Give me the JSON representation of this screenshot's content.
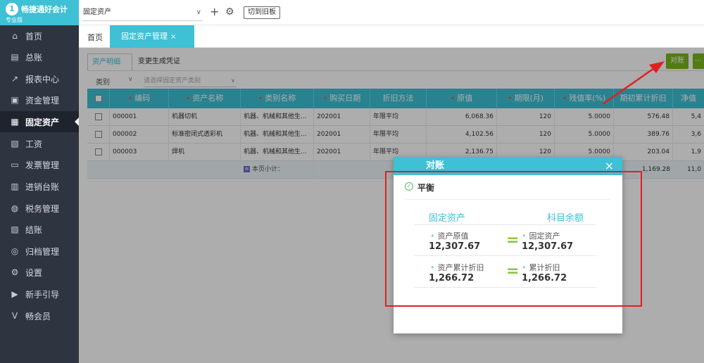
{
  "brand": {
    "logo_glyph": "1",
    "name": "畅捷通好会计",
    "edition": "专业版"
  },
  "sidebar": {
    "items": [
      {
        "label": "首页",
        "icon": "home-icon",
        "glyph": "⌂"
      },
      {
        "label": "总账",
        "icon": "ledger-icon",
        "glyph": "▤"
      },
      {
        "label": "报表中心",
        "icon": "chart-icon",
        "glyph": "↗"
      },
      {
        "label": "资金管理",
        "icon": "wallet-icon",
        "glyph": "▣"
      },
      {
        "label": "固定资产",
        "icon": "asset-icon",
        "glyph": "▦"
      },
      {
        "label": "工资",
        "icon": "salary-icon",
        "glyph": "▧"
      },
      {
        "label": "发票管理",
        "icon": "invoice-icon",
        "glyph": "▭"
      },
      {
        "label": "进销台账",
        "icon": "inventory-icon",
        "glyph": "▥"
      },
      {
        "label": "税务管理",
        "icon": "tax-icon",
        "glyph": "◍"
      },
      {
        "label": "结账",
        "icon": "closing-icon",
        "glyph": "▨"
      },
      {
        "label": "归档管理",
        "icon": "archive-icon",
        "glyph": "◎"
      },
      {
        "label": "设置",
        "icon": "gear-icon",
        "glyph": "⚙"
      },
      {
        "label": "新手引导",
        "icon": "guide-icon",
        "glyph": "▶"
      },
      {
        "label": "畅会员",
        "icon": "vip-icon",
        "glyph": "V"
      }
    ],
    "active_index": 4
  },
  "topbar": {
    "company": "固定资产",
    "dropdown_glyph": "∨",
    "plus_glyph": "+",
    "gear_glyph": "⚙",
    "switch_old_label": "切到旧板"
  },
  "tabs": {
    "home": "首页",
    "active": "固定资产管理",
    "close_glyph": "×"
  },
  "content": {
    "subtab_cards": "资产明细",
    "subtab_changes": "变更生成凭证",
    "filter_category_label": "类别",
    "filter_dropdown_glyph": "∨",
    "filter_placeholder": "请选择固定资产类别",
    "reconcile_button": "对账",
    "next_button_fragment": "⋯"
  },
  "table": {
    "columns": [
      "编码",
      "资产名称",
      "类别名称",
      "购买日期",
      "折旧方法",
      "原值",
      "期限(月)",
      "残值率(%)",
      "期初累计折旧",
      "净值"
    ],
    "rows": [
      [
        "000001",
        "机器切机",
        "机器、机械和其他生...",
        "202001",
        "年限平均",
        "6,068.36",
        "120",
        "5.0000",
        "576.48",
        "5,4"
      ],
      [
        "000002",
        "标准密闭式透彩机",
        "机器、机械和其他生...",
        "202001",
        "年限平均",
        "4,102.56",
        "120",
        "5.0000",
        "389.76",
        "3,6"
      ],
      [
        "000003",
        "焊机",
        "机器、机械和其他生...",
        "202001",
        "年限平均",
        "2,136.75",
        "120",
        "5.0000",
        "203.04",
        "1,9"
      ]
    ],
    "summary_icon": "≡",
    "summary_label": "本页小计：",
    "summary_depr": "1,169.28",
    "summary_net": "11,0"
  },
  "dialog": {
    "title": "对账",
    "close_glyph": "×",
    "check_glyph": "✓",
    "status": "平衡",
    "left_title": "固定资产",
    "right_title": "科目余额",
    "bullet": "•",
    "eq_glyph": "=",
    "pairs": [
      {
        "left_label": "资产原值",
        "left_value": "12,307.67",
        "right_label": "固定资产",
        "right_value": "12,307.67"
      },
      {
        "left_label": "资产累计折旧",
        "left_value": "1,266.72",
        "right_label": "累计折旧",
        "right_value": "1,266.72"
      }
    ]
  },
  "colors": {
    "accent": "#3ec0d5",
    "sidebar": "#2f3441",
    "green": "#7ab51d",
    "annotation_red": "#e02020"
  }
}
